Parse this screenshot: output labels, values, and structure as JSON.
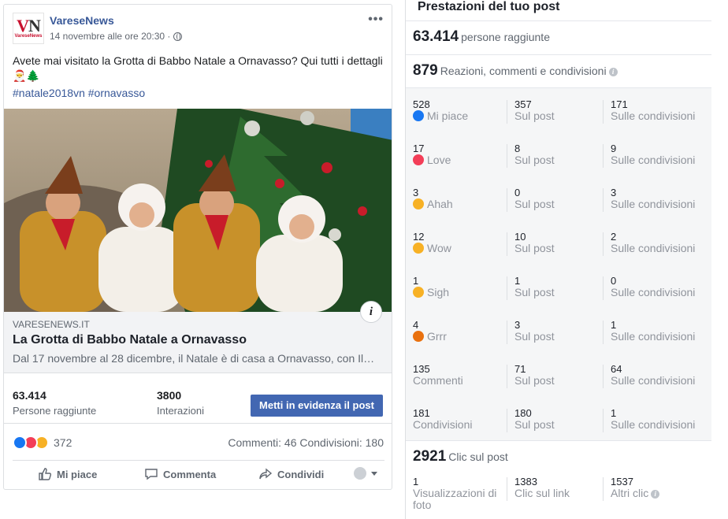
{
  "post": {
    "page_name": "VareseNews",
    "logo_text_v": "V",
    "logo_text_n": "N",
    "logo_small": "VareseNews",
    "time": "14 novembre alle ore 20:30 ·",
    "more": "•••",
    "text": "Avete mai visitato la Grotta di Babbo Natale a Ornavasso? Qui tutti i dettagli 🎅🌲",
    "hashtags": "#natale2018vn #ornavasso",
    "info_icon": "i",
    "link": {
      "domain": "VARESENEWS.IT",
      "title": "La Grotta di Babbo Natale a Ornavasso",
      "description": "Dal 17 novembre al 28 dicembre, il Natale è di casa a Ornavasso, con Il…"
    },
    "stats": {
      "reach_value": "63.414",
      "reach_label": "Persone raggiunte",
      "interactions_value": "3800",
      "interactions_label": "Interazioni",
      "boost_label": "Metti in evidenza il post"
    },
    "reactions_count": "372",
    "comments_shares": "Commenti: 46  Condivisioni: 180",
    "actions": {
      "like": "Mi piace",
      "comment": "Commenta",
      "share": "Condividi"
    }
  },
  "insights": {
    "title": "Prestazioni del tuo post",
    "reach_value": "63.414",
    "reach_label": "persone raggiunte",
    "engagement_value": "879",
    "engagement_label": "Reazioni, commenti e condivisioni",
    "rows": [
      {
        "total": "528",
        "label": "Mi piace",
        "emoji": "like",
        "on_post": "357",
        "on_post_label": "Sul post",
        "on_shares": "171",
        "on_shares_label": "Sulle condivisioni"
      },
      {
        "total": "17",
        "label": "Love",
        "emoji": "love",
        "on_post": "8",
        "on_post_label": "Sul post",
        "on_shares": "9",
        "on_shares_label": "Sulle condivisioni"
      },
      {
        "total": "3",
        "label": "Ahah",
        "emoji": "haha",
        "on_post": "0",
        "on_post_label": "Sul post",
        "on_shares": "3",
        "on_shares_label": "Sulle condivisioni"
      },
      {
        "total": "12",
        "label": "Wow",
        "emoji": "wow",
        "on_post": "10",
        "on_post_label": "Sul post",
        "on_shares": "2",
        "on_shares_label": "Sulle condivisioni"
      },
      {
        "total": "1",
        "label": "Sigh",
        "emoji": "sad",
        "on_post": "1",
        "on_post_label": "Sul post",
        "on_shares": "0",
        "on_shares_label": "Sulle condivisioni"
      },
      {
        "total": "4",
        "label": "Grrr",
        "emoji": "angry",
        "on_post": "3",
        "on_post_label": "Sul post",
        "on_shares": "1",
        "on_shares_label": "Sulle condivisioni"
      },
      {
        "total": "135",
        "label": "Commenti",
        "emoji": "",
        "on_post": "71",
        "on_post_label": "Sul post",
        "on_shares": "64",
        "on_shares_label": "Sulle condivisioni"
      },
      {
        "total": "181",
        "label": "Condivisioni",
        "emoji": "",
        "on_post": "180",
        "on_post_label": "Sul post",
        "on_shares": "1",
        "on_shares_label": "Sulle condivisioni"
      }
    ],
    "clicks_value": "2921",
    "clicks_label": "Clic sul post",
    "photo_views_value": "1",
    "photo_views_label": "Visualizzazioni di foto",
    "link_clicks_value": "1383",
    "link_clicks_label": "Clic sul link",
    "other_clicks_value": "1537",
    "other_clicks_label": "Altri clic"
  },
  "colors": {
    "facebook_blue": "#4267b2",
    "link_blue": "#385898",
    "like_blue": "#1877f2",
    "love_red": "#f33e58",
    "emoji_yellow": "#f7b125",
    "angry_orange": "#e9710f"
  }
}
